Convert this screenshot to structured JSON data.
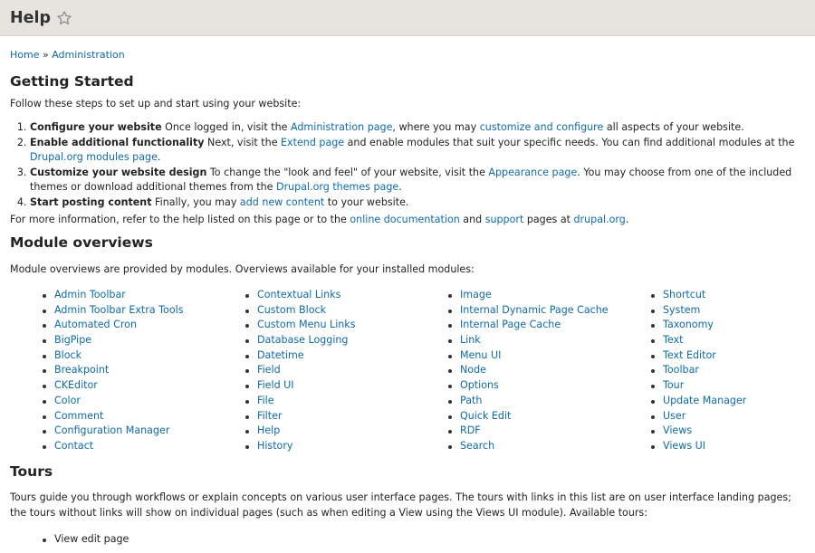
{
  "header": {
    "title": "Help",
    "star_icon": "star-outline-icon"
  },
  "breadcrumb": {
    "home": "Home",
    "sep": "»",
    "admin": "Administration"
  },
  "getting_started": {
    "heading": "Getting Started",
    "intro": "Follow these steps to set up and start using your website:",
    "steps": [
      {
        "title": "Configure your website",
        "t1": " Once logged in, visit the ",
        "l1": "Administration page",
        "t2": ", where you may ",
        "l2": "customize and configure",
        "t3": " all aspects of your website."
      },
      {
        "title": "Enable additional functionality",
        "t1": " Next, visit the ",
        "l1": "Extend page",
        "t2": " and enable modules that suit your specific needs. You can find additional modules at the ",
        "l2": "Drupal.org modules page",
        "t3": "."
      },
      {
        "title": "Customize your website design",
        "t1": " To change the \"look and feel\" of your website, visit the ",
        "l1": "Appearance page",
        "t2": ". You may choose from one of the included themes or download additional themes from the ",
        "l2": "Drupal.org themes page",
        "t3": "."
      },
      {
        "title": "Start posting content",
        "t1": " Finally, you may ",
        "l1": "add new content",
        "t2": " to your website."
      }
    ],
    "more": {
      "t1": "For more information, refer to the help listed on this page or to the ",
      "l1": "online documentation",
      "t2": " and ",
      "l2": "support",
      "t3": " pages at ",
      "l3": "drupal.org",
      "t4": "."
    }
  },
  "module_overviews": {
    "heading": "Module overviews",
    "intro": "Module overviews are provided by modules. Overviews available for your installed modules:",
    "columns": [
      [
        "Admin Toolbar",
        "Admin Toolbar Extra Tools",
        "Automated Cron",
        "BigPipe",
        "Block",
        "Breakpoint",
        "CKEditor",
        "Color",
        "Comment",
        "Configuration Manager",
        "Contact"
      ],
      [
        "Contextual Links",
        "Custom Block",
        "Custom Menu Links",
        "Database Logging",
        "Datetime",
        "Field",
        "Field UI",
        "File",
        "Filter",
        "Help",
        "History"
      ],
      [
        "Image",
        "Internal Dynamic Page Cache",
        "Internal Page Cache",
        "Link",
        "Menu UI",
        "Node",
        "Options",
        "Path",
        "Quick Edit",
        "RDF",
        "Search"
      ],
      [
        "Shortcut",
        "System",
        "Taxonomy",
        "Text",
        "Text Editor",
        "Toolbar",
        "Tour",
        "Update Manager",
        "User",
        "Views",
        "Views UI"
      ]
    ]
  },
  "tours": {
    "heading": "Tours",
    "intro": "Tours guide you through workflows or explain concepts on various user interface pages. The tours with links in this list are on user interface landing pages; the tours without links will show on individual pages (such as when editing a View using the Views UI module). Available tours:",
    "items": [
      "View edit page"
    ]
  }
}
